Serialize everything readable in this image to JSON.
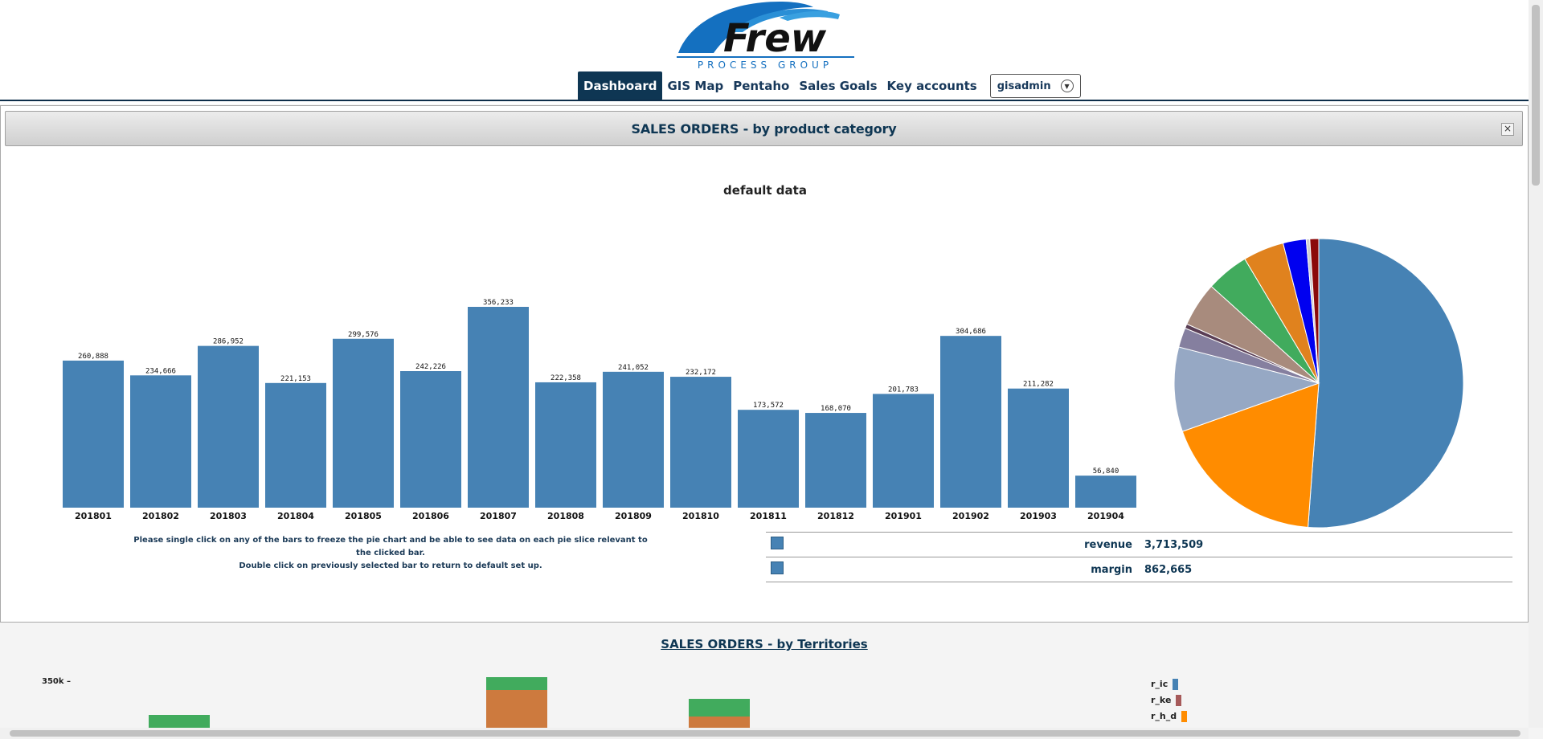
{
  "nav": {
    "items": [
      "Dashboard",
      "GIS Map",
      "Pentaho",
      "Sales Goals",
      "Key accounts"
    ],
    "active": "Dashboard",
    "user": "gisadmin"
  },
  "logo": {
    "brand": "Frew",
    "tagline": "PROCESS GROUP"
  },
  "panel": {
    "title": "SALES ORDERS - by product category",
    "close": "×",
    "chart_title": "default data",
    "instructions": [
      "Please single click on any of the bars to freeze the pie chart and be able to see data on each pie slice relevant to the clicked bar.",
      "Double click on previously selected bar to return to default set up."
    ]
  },
  "chart_data": [
    {
      "type": "bar",
      "title": "default data",
      "categories": [
        "201801",
        "201802",
        "201803",
        "201804",
        "201805",
        "201806",
        "201807",
        "201808",
        "201809",
        "201810",
        "201811",
        "201812",
        "201901",
        "201902",
        "201903",
        "201904"
      ],
      "values": [
        260888,
        234666,
        286952,
        221153,
        299576,
        242226,
        356233,
        222358,
        241052,
        232172,
        173572,
        168070,
        201783,
        304686,
        211282,
        56840
      ],
      "value_labels": [
        "260,888",
        "234,666",
        "286,952",
        "221,153",
        "299,576",
        "242,226",
        "356,233",
        "222,358",
        "241,052",
        "232,172",
        "173,572",
        "168,070",
        "201,783",
        "304,686",
        "211,282",
        "56,840"
      ],
      "color": "#4682b4",
      "ylim": [
        0,
        356233
      ]
    },
    {
      "type": "pie",
      "values": [
        51.5,
        18.5,
        9.5,
        2.2,
        0.5,
        5.0,
        4.8,
        4.6,
        2.6,
        0.4,
        1.0
      ],
      "colors": [
        "#4682b4",
        "#ff8c00",
        "#96a8c4",
        "#857f9f",
        "#5a3e55",
        "#a88b7d",
        "#41ab5d",
        "#e0821e",
        "#0000f0",
        "#cfcfcf",
        "#8b0a0a"
      ]
    }
  ],
  "legend": [
    {
      "label": "revenue",
      "value": "3,713,509"
    },
    {
      "label": "margin",
      "value": "862,665"
    }
  ],
  "lower": {
    "title": "SALES ORDERS - by Territories",
    "axis_label": "350k –",
    "legend": [
      "r_ic",
      "r_ke",
      "r_h_d"
    ],
    "legend_colors": [
      "#4682b4",
      "#a65a5a",
      "#ff8c00"
    ]
  }
}
